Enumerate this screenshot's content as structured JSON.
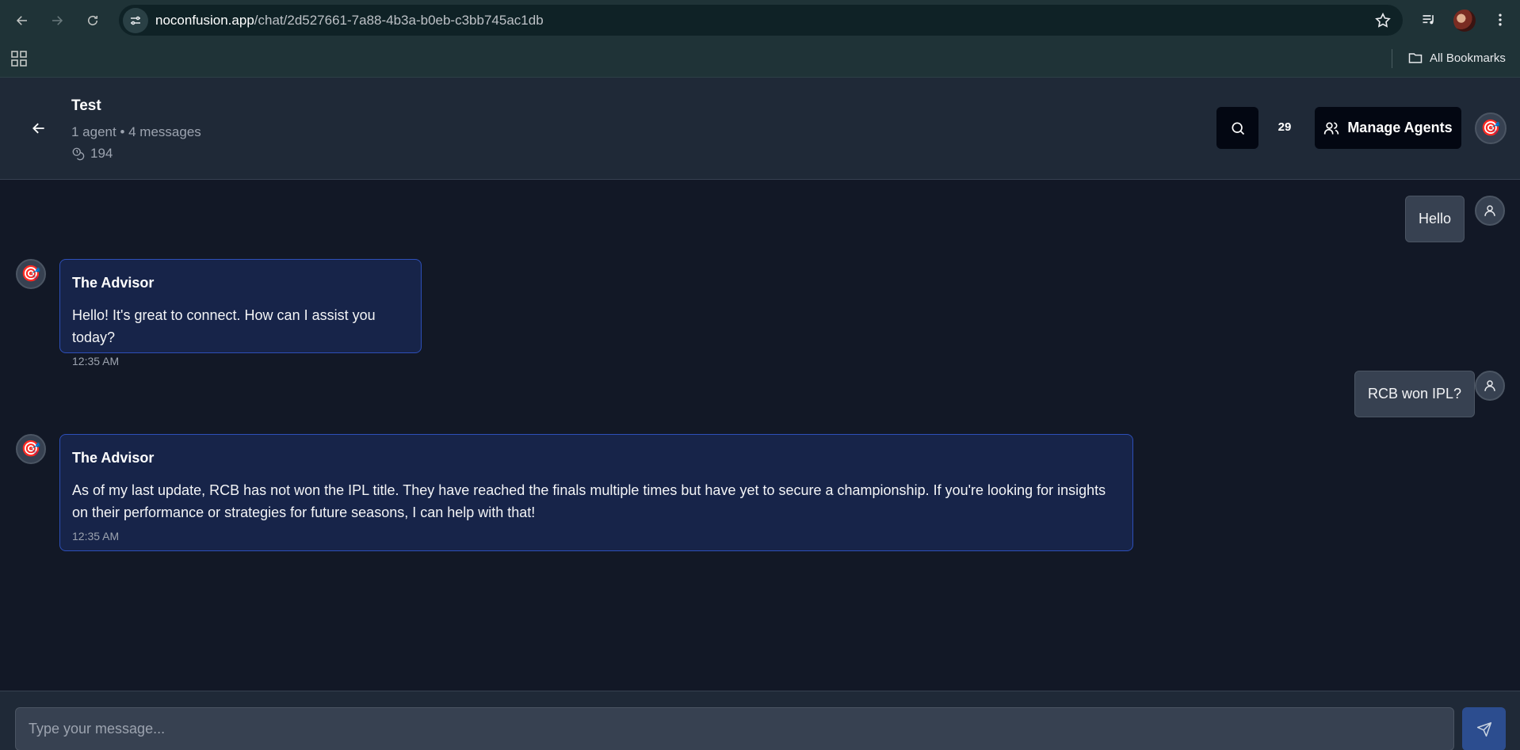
{
  "browser": {
    "url_host": "noconfusion.app",
    "url_path": "/chat/2d527661-7a88-4b3a-b0eb-c3bb745ac1db",
    "bookmarks_label": "All Bookmarks"
  },
  "header": {
    "title": "Test",
    "meta": "1 agent • 4 messages",
    "token_count": "194",
    "badge_count": "29",
    "manage_agents_label": "Manage Agents",
    "agent_icon": "🎯"
  },
  "messages": [
    {
      "role": "user",
      "text": "Hello"
    },
    {
      "role": "agent",
      "name": "The Advisor",
      "text": "Hello! It's great to connect. How can I assist you today?",
      "time": "12:35 AM",
      "icon": "🎯"
    },
    {
      "role": "user",
      "text": "RCB won IPL?"
    },
    {
      "role": "agent",
      "name": "The Advisor",
      "text": "As of my last update, RCB has not won the IPL title. They have reached the finals multiple times but have yet to secure a championship. If you're looking for insights on their performance or strategies for future seasons, I can help with that!",
      "time": "12:35 AM",
      "icon": "🎯"
    }
  ],
  "input": {
    "placeholder": "Type your message..."
  }
}
